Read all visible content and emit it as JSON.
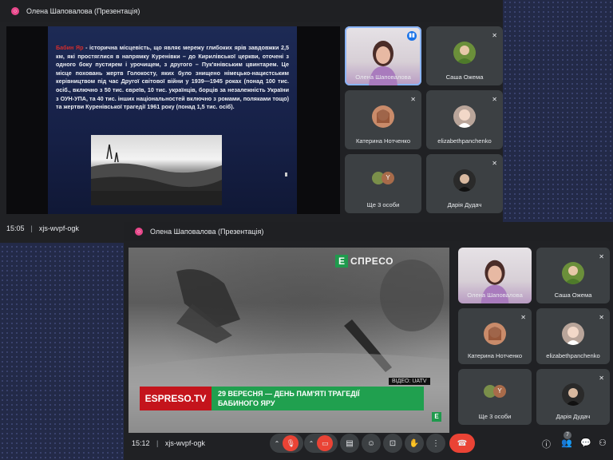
{
  "window1": {
    "title": "Олена Шаповалова (Презентація)",
    "time": "15:05",
    "meeting_code": "xjs-wvpf-ogk",
    "slide": {
      "highlight": "Бабин Яр",
      "body": " - історична місцевість, що являє мережу глибоких ярів завдовжки 2,5 км, які простяглися в напрямку Куренівки – до Кирилівської церкви, оточені з одного боку пустирем і урочищем, з другого – Пук'янівським цвинтарем. Це місце поховань жертв Голокосту, яких було знищено німецько-нацистським керівництвом під час Другої світової війни у 1939—1945 роках (понад 100 тис. осіб., включно з 50 тис. євреїв, 10 тис. українців, борців за незалежність України з ОУН-УПА, та 40 тис. інших національностей включно з ромами, поляками тощо) та жертви Куренівської трагедії 1961 року (понад 1,5 тис. осіб)."
    },
    "tiles": [
      {
        "name": "Олена Шаповалова"
      },
      {
        "name": "Саша Ожема"
      },
      {
        "name": "Катерина Нотченко"
      },
      {
        "name": "elizabethpanchenko"
      },
      {
        "name": "Ще 3 особи"
      },
      {
        "name": "Дарія Дудач"
      }
    ]
  },
  "window2": {
    "title": "Олена Шаповалова (Презентація)",
    "time": "15:12",
    "meeting_code": "xjs-wvpf-ogk",
    "video": {
      "logo_letter": "Е",
      "logo_text": "СПРЕСО",
      "credit": "ВІДЕО: UATV",
      "brand": "ESPRESO.TV",
      "headline_line1": "29 ВЕРЕСНЯ — ДЕНЬ ПАМ'ЯТІ ТРАГЕДІЇ",
      "headline_line2": "БАБИНОГО ЯРУ",
      "corner": "Е"
    },
    "tiles": [
      {
        "name": "Олена Шаповалова"
      },
      {
        "name": "Саша Ожема"
      },
      {
        "name": "Катерина Нотченко"
      },
      {
        "name": "elizabethpanchenko"
      },
      {
        "name": "Ще 3 особи"
      },
      {
        "name": "Дарія Дудач"
      }
    ],
    "people_badge": "7",
    "others_initial": "Y"
  },
  "colors": {
    "accent": "#8ab4f8",
    "danger": "#ea4335",
    "brand_green": "#20a04f",
    "brand_red": "#c4141c"
  }
}
